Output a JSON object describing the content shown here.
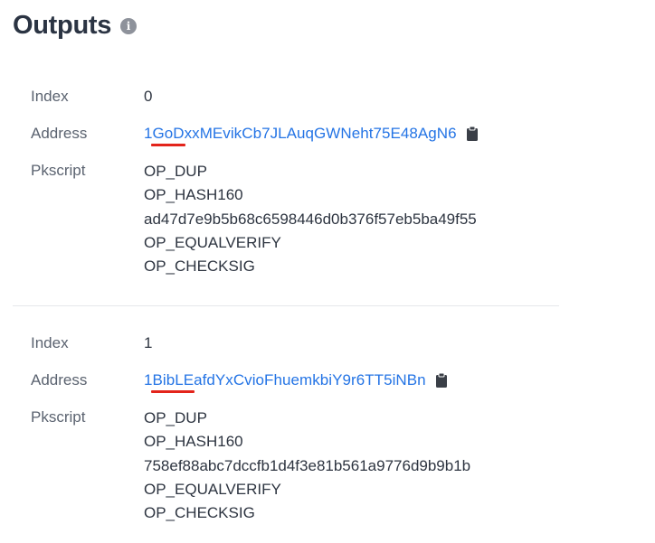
{
  "header": {
    "title": "Outputs",
    "info_icon": "info-circle-icon"
  },
  "outputs": [
    {
      "index_label": "Index",
      "index": "0",
      "address_label": "Address",
      "address": "1GoDxxMEvikCb7JLAuqGWNeht75E48AgN6",
      "copy_icon": "clipboard-icon",
      "pkscript_label": "Pkscript",
      "pkscript": [
        "OP_DUP",
        "OP_HASH160",
        "ad47d7e9b5b68c6598446d0b376f57eb5ba49f55",
        "OP_EQUALVERIFY",
        "OP_CHECKSIG"
      ]
    },
    {
      "index_label": "Index",
      "index": "1",
      "address_label": "Address",
      "address": "1BibLEafdYxCvioFhuemkbiY9r6TT5iNBn",
      "copy_icon": "clipboard-icon",
      "pkscript_label": "Pkscript",
      "pkscript": [
        "OP_DUP",
        "OP_HASH160",
        "758ef88abc7dccfb1d4f3e81b561a9776d9b9b1b",
        "OP_EQUALVERIFY",
        "OP_CHECKSIG"
      ]
    }
  ],
  "colors": {
    "link": "#2474e5",
    "highlight_underline": "#e3241b",
    "title": "#2b3443"
  }
}
